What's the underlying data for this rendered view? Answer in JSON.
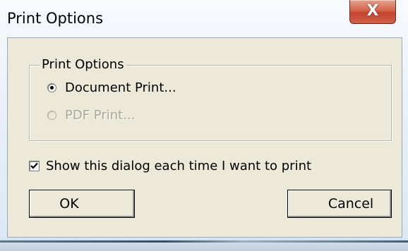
{
  "window": {
    "title": "Print Options",
    "close_glyph": "X"
  },
  "group": {
    "label": "Print Options",
    "options": [
      {
        "label": "Document Print...",
        "checked": true,
        "enabled": true
      },
      {
        "label": "PDF Print...",
        "checked": false,
        "enabled": false
      }
    ]
  },
  "show_dialog": {
    "label": "Show this dialog each time I want to print",
    "checked": true
  },
  "buttons": {
    "ok_label": "OK",
    "cancel_label": "Cancel"
  },
  "colors": {
    "dialog_face": "#ece9d8",
    "close_red": "#c2452e",
    "disabled_text": "#a8a698"
  },
  "icons": {
    "close": "close-icon",
    "check": "checkmark-icon",
    "radio_selected": "radio-dot-icon"
  }
}
